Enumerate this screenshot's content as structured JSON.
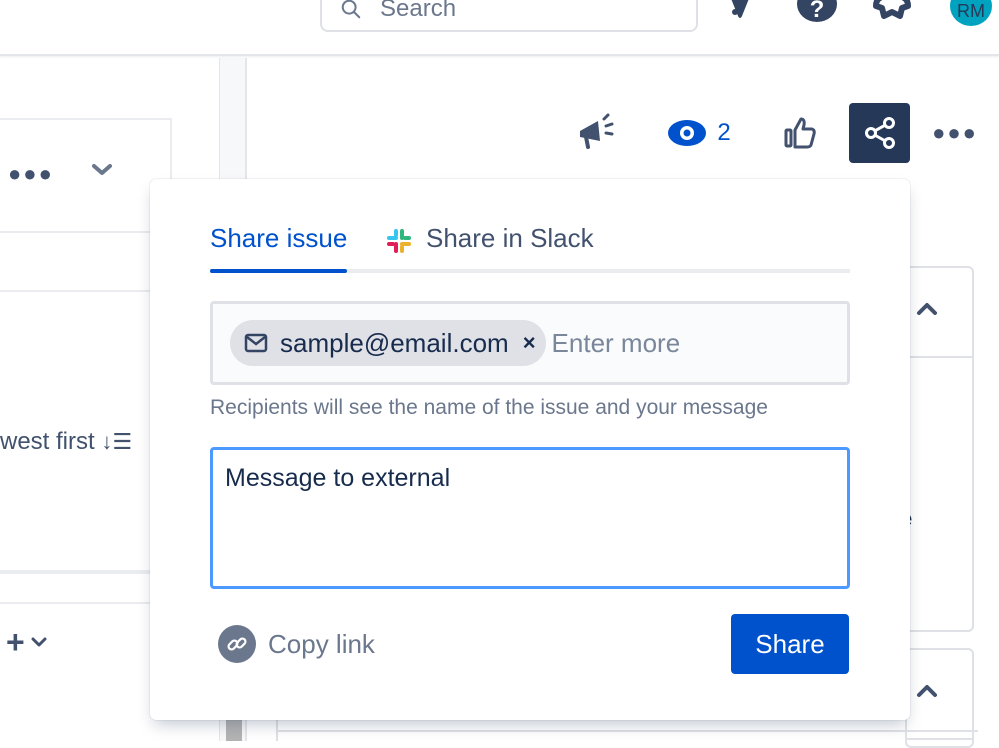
{
  "topbar": {
    "search_placeholder": "Search",
    "icons": [
      "notifications-bell-icon",
      "help-icon",
      "settings-gear-icon"
    ],
    "avatar_initials": "RM",
    "avatar_color": "#00a3bf"
  },
  "left_panel": {
    "sort_label": "west first",
    "sort_icon": "sort-descending-icon",
    "add_label": "+"
  },
  "issue_actions": {
    "feedback_icon": "megaphone-icon",
    "watch_icon": "eye-icon",
    "watchers_count": "2",
    "like_icon": "thumbs-up-icon",
    "share_icon": "share-icon",
    "more_icon": "more-dots-icon"
  },
  "share_popup": {
    "tabs": [
      {
        "label": "Share issue",
        "active": true
      },
      {
        "label": "Share in Slack",
        "active": false,
        "icon": "slack-icon"
      }
    ],
    "recipients": [
      {
        "email": "sample@email.com",
        "icon": "mail-icon"
      }
    ],
    "recipients_placeholder": "Enter more",
    "helper_text": "Recipients will see the name of the issue and your message",
    "message_value": "Message to external",
    "copy_link_label": "Copy link",
    "share_button_label": "Share"
  },
  "right_panel": {
    "partial_text": "e"
  },
  "colors": {
    "primary": "#0052cc",
    "dark_nav": "#253858",
    "focus_border": "#4c9aff",
    "muted_text": "#6b778c"
  }
}
